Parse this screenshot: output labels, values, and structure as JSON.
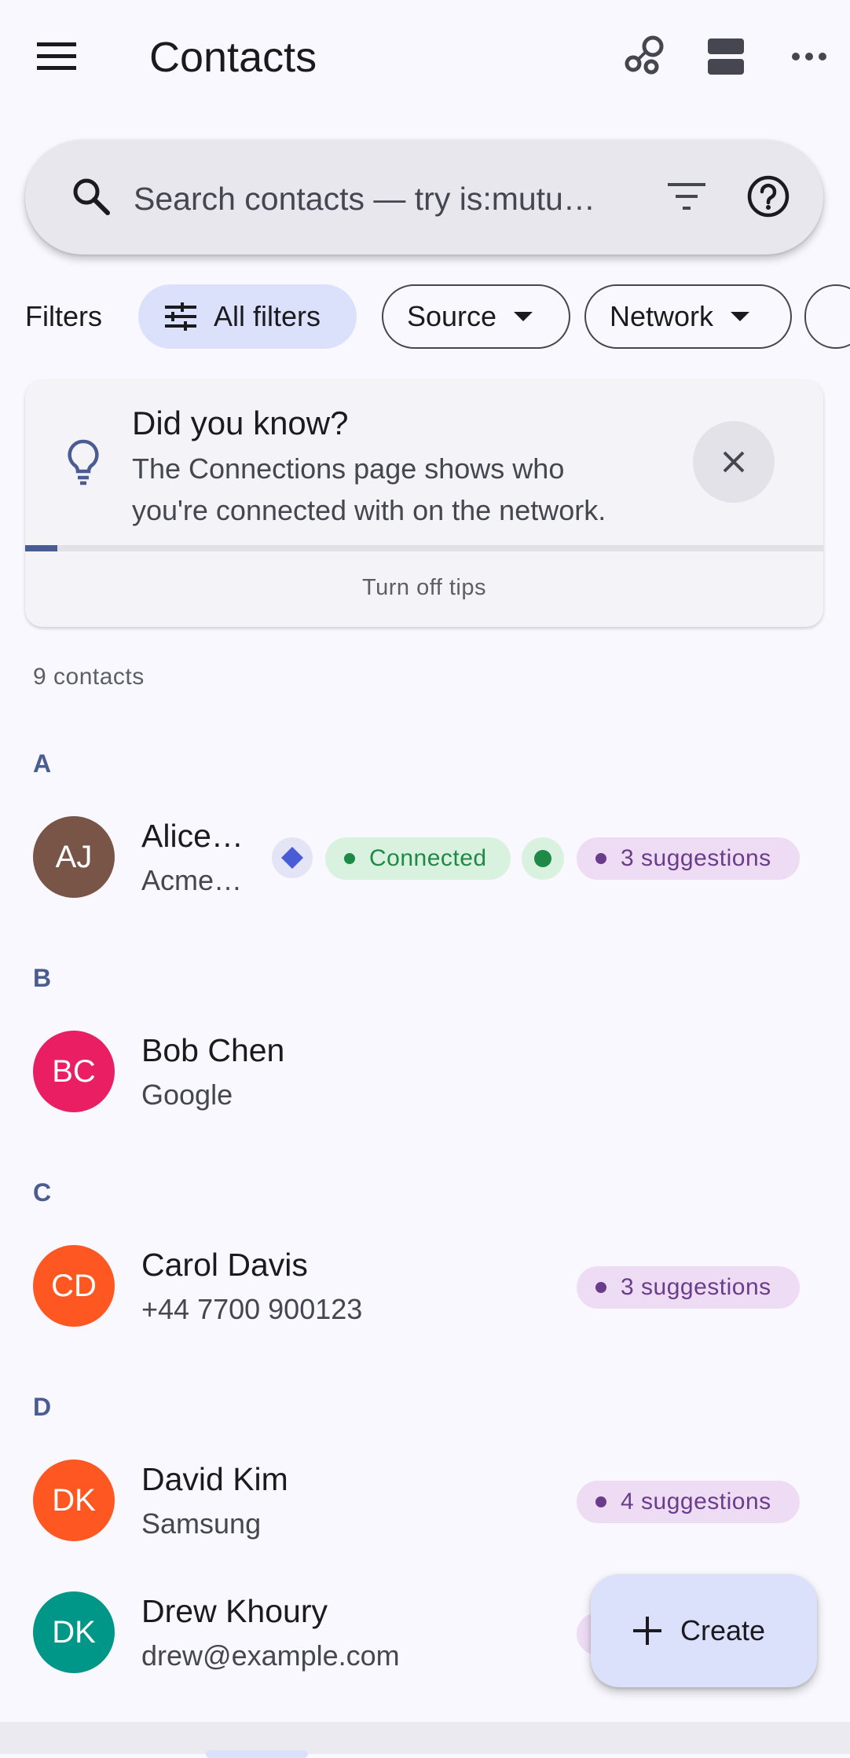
{
  "header": {
    "title": "Contacts"
  },
  "search": {
    "placeholder": "Search contacts — try is:mutu…"
  },
  "filters": {
    "label": "Filters",
    "chips": [
      {
        "label": "All filters"
      },
      {
        "label": "Source"
      },
      {
        "label": "Network"
      }
    ]
  },
  "tip": {
    "title": "Did you know?",
    "body": "The Connections page shows who you're connected with on the network.",
    "turn_off": "Turn off tips",
    "progress_fraction": 0.04
  },
  "contacts_count": "9 contacts",
  "sections": [
    {
      "letter": "A"
    },
    {
      "letter": "B"
    },
    {
      "letter": "C"
    },
    {
      "letter": "D"
    }
  ],
  "contacts": [
    {
      "initials": "AJ",
      "name": "Alice…",
      "subtitle": "Acme …",
      "avatar_color": "#795548",
      "status": "Connected",
      "suggestions": "3 suggestions"
    },
    {
      "initials": "BC",
      "name": "Bob Chen",
      "subtitle": "Google",
      "avatar_color": "#e91e63"
    },
    {
      "initials": "CD",
      "name": "Carol Davis",
      "subtitle": "+44 7700 900123",
      "avatar_color": "#ff5722",
      "suggestions": "3 suggestions"
    },
    {
      "initials": "DK",
      "name": "David Kim",
      "subtitle": "Samsung",
      "avatar_color": "#ff5722",
      "suggestions": "4 suggestions"
    },
    {
      "initials": "DK",
      "name": "Drew Khoury",
      "subtitle": "drew@example.com",
      "avatar_color": "#009688"
    }
  ],
  "fab": {
    "label": "Create"
  },
  "colors": {
    "accent": "#4b5c92",
    "suggestion_badge": "#eedcf5",
    "connected_badge": "#d9f2df",
    "network_diamond": "#4a5bd6",
    "network_dot": "#1e8a45"
  }
}
